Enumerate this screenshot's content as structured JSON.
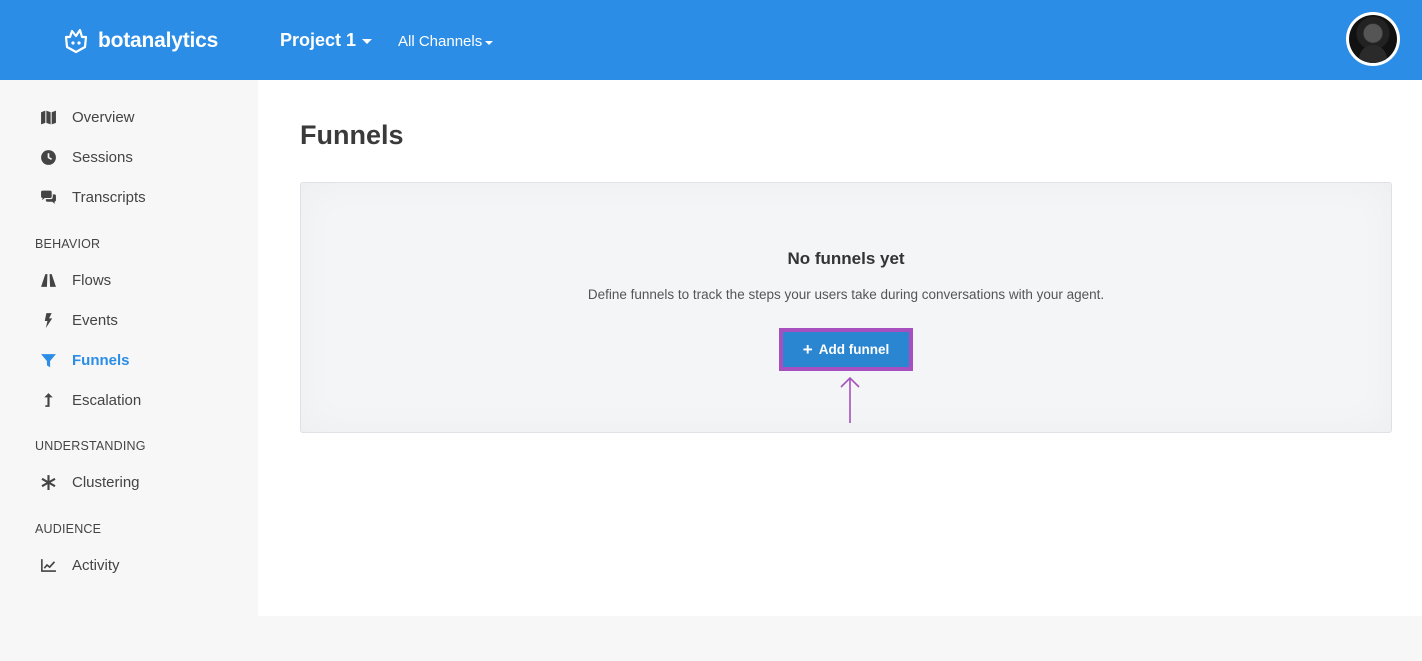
{
  "header": {
    "brand": "botanalytics",
    "project": "Project 1",
    "channels": "All Channels"
  },
  "sidebar": {
    "items_top": [
      {
        "label": "Overview",
        "icon": "map-icon"
      },
      {
        "label": "Sessions",
        "icon": "clock-icon"
      },
      {
        "label": "Transcripts",
        "icon": "chat-icon"
      }
    ],
    "sections": {
      "behavior": "BEHAVIOR",
      "understanding": "UNDERSTANDING",
      "audience": "AUDIENCE"
    },
    "behavior_items": [
      {
        "label": "Flows",
        "icon": "road-icon"
      },
      {
        "label": "Events",
        "icon": "bolt-icon"
      },
      {
        "label": "Funnels",
        "icon": "filter-icon",
        "active": true
      },
      {
        "label": "Escalation",
        "icon": "arrow-up-icon"
      }
    ],
    "understanding_items": [
      {
        "label": "Clustering",
        "icon": "asterisk-icon"
      }
    ],
    "audience_items": [
      {
        "label": "Activity",
        "icon": "line-chart-icon"
      }
    ]
  },
  "main": {
    "title": "Funnels",
    "empty": {
      "title": "No funnels yet",
      "description": "Define funnels to track the steps your users take during conversations with your agent.",
      "button": "Add funnel"
    }
  },
  "colors": {
    "accent": "#2b8de6",
    "highlight": "#a84fc0"
  }
}
